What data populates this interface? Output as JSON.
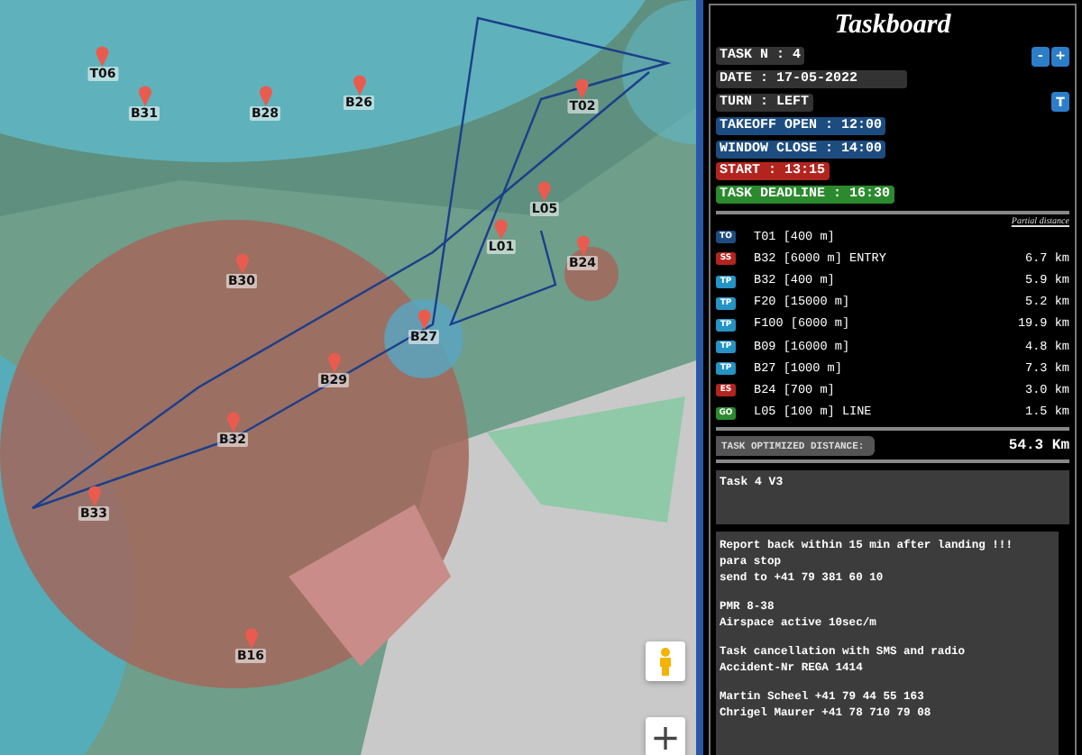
{
  "map": {
    "waypoints": [
      {
        "label": "T06"
      },
      {
        "label": "B31"
      },
      {
        "label": "B28"
      },
      {
        "label": "B26"
      },
      {
        "label": "T02"
      },
      {
        "label": "L05"
      },
      {
        "label": "L01"
      },
      {
        "label": "B24"
      },
      {
        "label": "B30"
      },
      {
        "label": "B27"
      },
      {
        "label": "B29"
      },
      {
        "label": "B32"
      },
      {
        "label": "B33"
      },
      {
        "label": "B16"
      }
    ],
    "zoom_in": "+"
  },
  "taskboard": {
    "title": "Taskboard",
    "info": [
      {
        "kind": "plain",
        "text": "TASK N : 4",
        "buttons": [
          "-",
          "+"
        ]
      },
      {
        "kind": "wide",
        "text": "DATE : 17-05-2022"
      },
      {
        "kind": "plain",
        "text": "TURN : LEFT",
        "buttons": [
          "T"
        ]
      },
      {
        "kind": "time",
        "text": "TAKEOFF OPEN : 12:00"
      },
      {
        "kind": "time",
        "text": "WINDOW CLOSE : 14:00"
      },
      {
        "kind": "start",
        "text": "START : 13:15"
      },
      {
        "kind": "deadline",
        "text": "TASK DEADLINE : 16:30"
      }
    ],
    "partial_heading": "Partial distance",
    "turnpoints": [
      {
        "kind": "takeoff",
        "badge": "TO",
        "name": "T01 [400 m]"
      },
      {
        "kind": "start",
        "badge": "SS",
        "name": "B32 [6000 m] ENTRY",
        "distance": "6.7 km"
      },
      {
        "kind": "turnpoint",
        "badge": "TP",
        "name": "B32 [400 m]",
        "distance": "5.9 km"
      },
      {
        "kind": "turnpoint",
        "badge": "TP",
        "name": "F20 [15000 m]",
        "distance": "5.2 km"
      },
      {
        "kind": "turnpoint",
        "badge": "TP",
        "name": "F100 [6000 m]",
        "distance": "19.9 km"
      },
      {
        "kind": "turnpoint",
        "badge": "TP",
        "name": "B09 [16000 m]",
        "distance": "4.8 km"
      },
      {
        "kind": "turnpoint",
        "badge": "TP",
        "name": "B27 [1000 m]",
        "distance": "7.3 km"
      },
      {
        "kind": "end",
        "badge": "ES",
        "name": "B24 [700 m]",
        "distance": "3.0 km"
      },
      {
        "kind": "goal",
        "badge": "GO",
        "name": "L05 [100 m] LINE",
        "distance": "1.5 km"
      }
    ],
    "optimized_label": "TASK OPTIMIZED DISTANCE:",
    "optimized_value": "54.3 Km",
    "task_name": "Task 4 V3",
    "notes": [
      [
        "Report back within 15 min after landing !!!",
        "para stop",
        "send to +41 79 381 60 10"
      ],
      [
        "PMR 8-38",
        "Airspace active 10sec/m"
      ],
      [
        "Task cancellation with SMS and radio",
        "Accident-Nr REGA 1414"
      ],
      [
        "Martin Scheel +41 79 44 55 163",
        "Chrigel Maurer +41 78 710 79 08"
      ]
    ]
  }
}
